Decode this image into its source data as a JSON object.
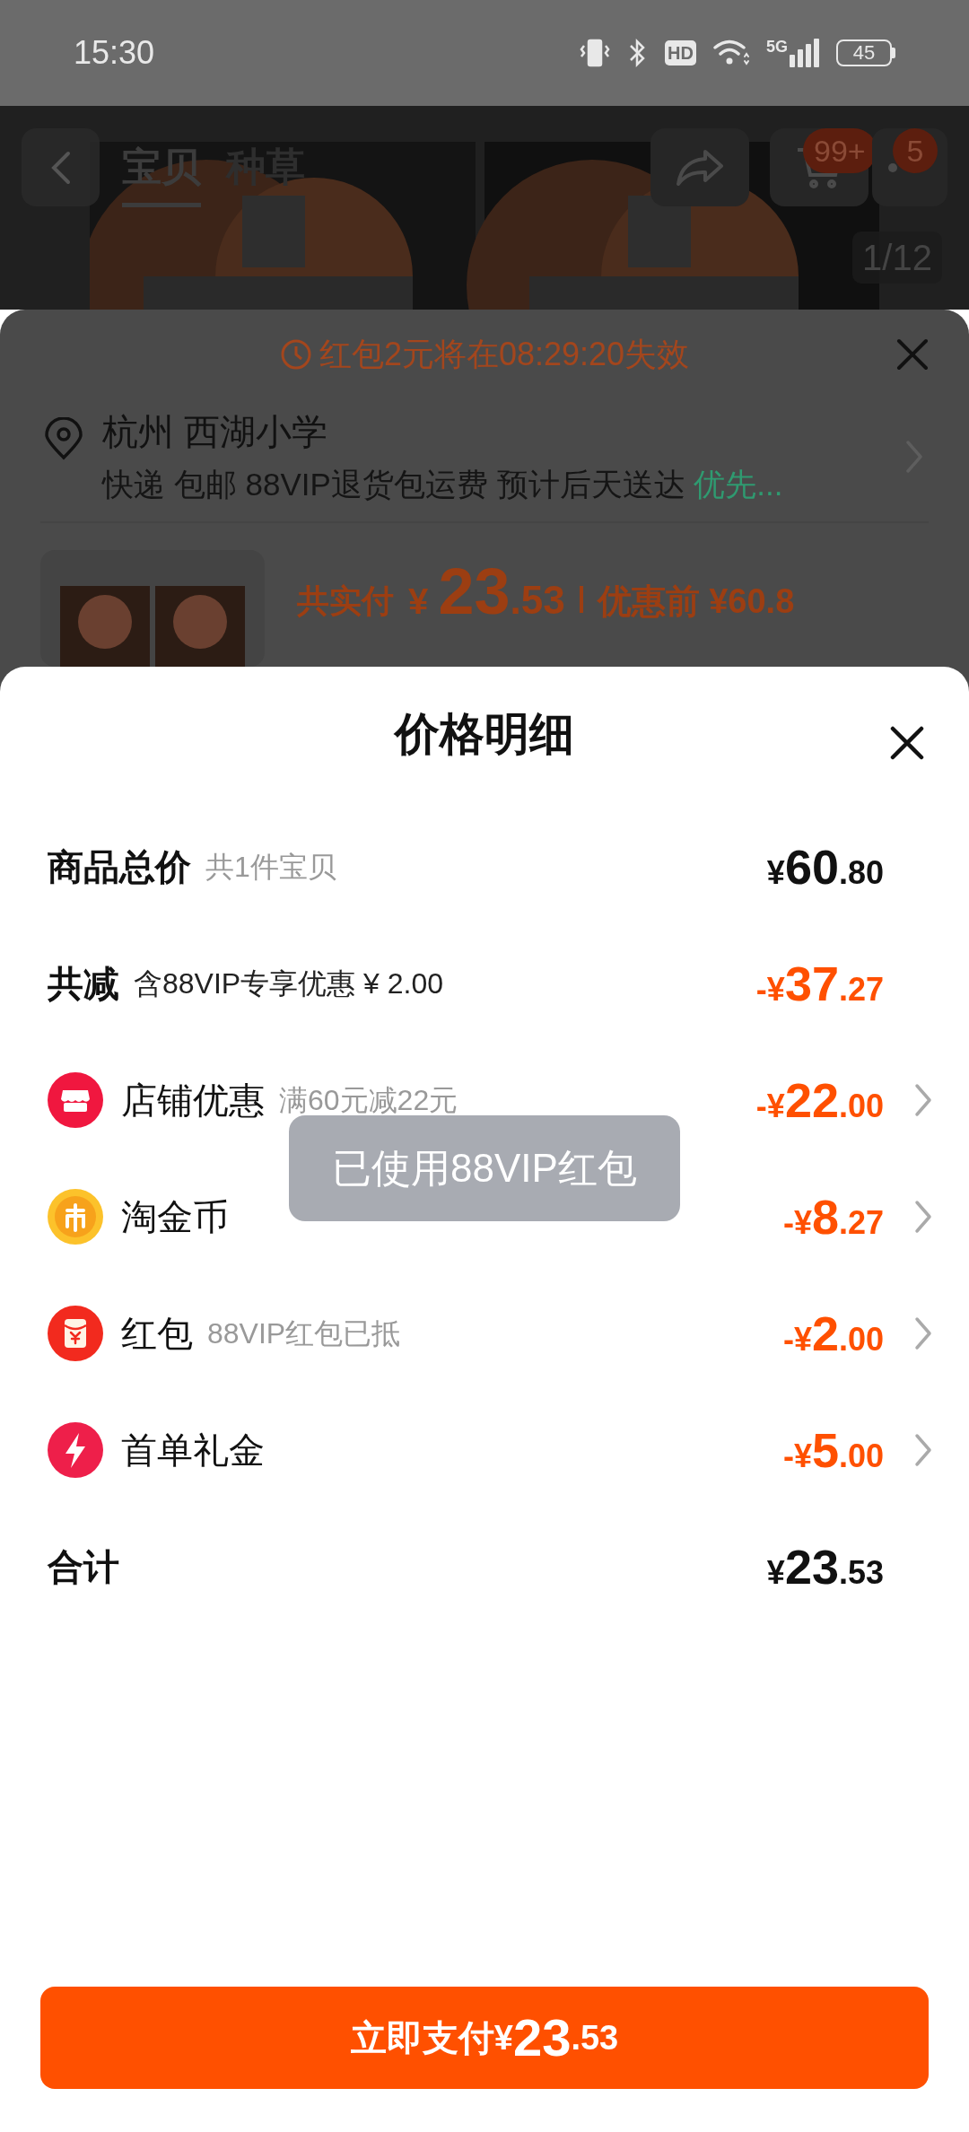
{
  "status_bar": {
    "time": "15:30",
    "hd": "HD",
    "network": "5G",
    "battery": "45"
  },
  "product_header": {
    "tabs": [
      {
        "label": "宝贝",
        "selected": true
      },
      {
        "label": "种草",
        "selected": false
      }
    ],
    "cart_badge": "99+",
    "more_badge": "5",
    "image_counter": "1/12"
  },
  "checkout_sheet": {
    "countdown": "红包2元将在08:29:20失效",
    "address": "杭州 西湖小学",
    "delivery": "快递 包邮 88VIP退货包运费 预计后天送达",
    "delivery_highlight": "优先...",
    "paid_label": "共实付",
    "paid": {
      "symbol": "¥",
      "integer": "23",
      "decimal": ".53"
    },
    "original_price": "优惠前 ¥60.8"
  },
  "price_detail": {
    "title": "价格明细",
    "rows": [
      {
        "kind": "summary",
        "label": "商品总价",
        "note": "共1件宝贝",
        "price": {
          "symbol": "¥",
          "integer": "60",
          "decimal": ".80"
        }
      },
      {
        "kind": "reduction",
        "label": "共减",
        "note": "含88VIP专享优惠 ¥ 2.00",
        "price": {
          "symbol": "-¥",
          "integer": "37",
          "decimal": ".27"
        }
      },
      {
        "kind": "store",
        "label": "店铺优惠",
        "note": "满60元减22元",
        "price": {
          "symbol": "-¥",
          "integer": "22",
          "decimal": ".00"
        }
      },
      {
        "kind": "coin",
        "label": "淘金币",
        "price": {
          "symbol": "-¥",
          "integer": "8",
          "decimal": ".27"
        }
      },
      {
        "kind": "envelope",
        "label": "红包",
        "note": "88VIP红包已抵",
        "price": {
          "symbol": "-¥",
          "integer": "2",
          "decimal": ".00"
        }
      },
      {
        "kind": "bolt",
        "label": "首单礼金",
        "price": {
          "symbol": "-¥",
          "integer": "5",
          "decimal": ".00"
        }
      },
      {
        "kind": "summary",
        "label": "合计",
        "price": {
          "symbol": "¥",
          "integer": "23",
          "decimal": ".53"
        }
      }
    ],
    "toast": "已使用88VIP红包",
    "pay_button": {
      "label": "立即支付",
      "symbol": "¥",
      "integer": "23",
      "decimal": ".53"
    }
  }
}
